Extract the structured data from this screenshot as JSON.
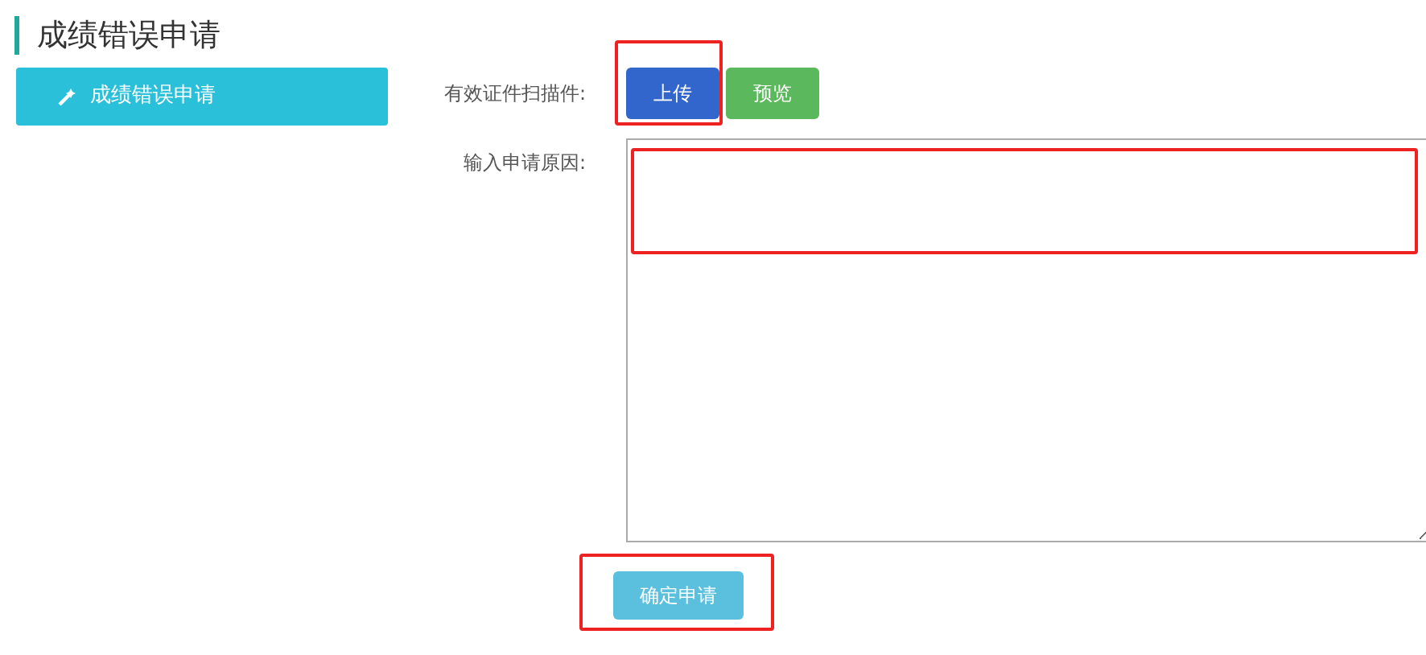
{
  "page_title": "成绩错误申请",
  "sidebar": {
    "items": [
      {
        "label": "成绩错误申请",
        "selected": true
      }
    ]
  },
  "form": {
    "scan_label": "有效证件扫描件:",
    "upload_button": {
      "label": "上传",
      "highlighted": true
    },
    "preview_button": {
      "label": "预览",
      "highlighted": false
    },
    "reason_label": "输入申请原因:",
    "reason_field": {
      "highlighted": true
    },
    "submit_button": {
      "label": "确定申请",
      "highlighted": true
    }
  }
}
